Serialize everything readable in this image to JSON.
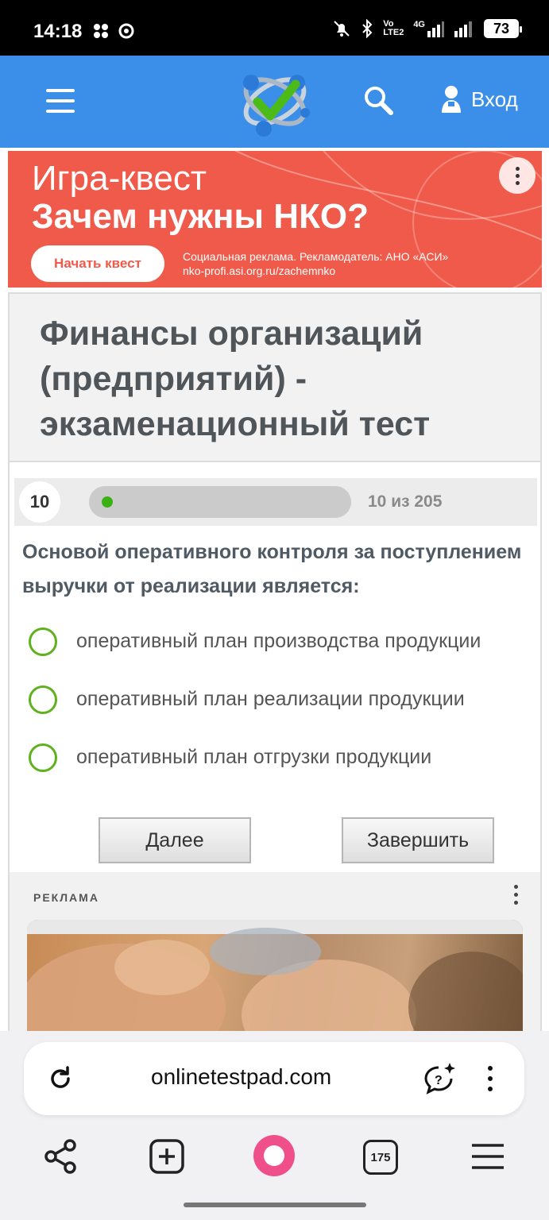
{
  "status_bar": {
    "time": "14:18",
    "network_label_top": "Vo",
    "network_label_bottom": "LTE2",
    "network_type": "4G",
    "battery": "73"
  },
  "header": {
    "login_label": "Вход",
    "icons": [
      "menu-icon",
      "site-logo",
      "search-icon",
      "user-icon"
    ]
  },
  "ad_banner": {
    "title": "Игра-квест",
    "subtitle": "Зачем нужны НКО?",
    "cta": "Начать квест",
    "disclaimer_line1": "Социальная реклама. Рекламодатель: АНО «АСИ»",
    "disclaimer_line2": "nko-profi.asi.org.ru/zachemnko",
    "color": "#f05a4a"
  },
  "test": {
    "title": "Финансы организаций (предприятий) - экзаменационный тест",
    "question_number": "10",
    "progress_text": "10 из 205",
    "progress_fraction": 0.049,
    "question": "Основой оперативного контроля за поступлением выручки от реализации является:",
    "options": [
      "оперативный план производства продукции",
      "оперативный план реализации продукции",
      "оперативный план отгрузки продукции"
    ],
    "next_label": "Далее",
    "finish_label": "Завершить",
    "accent_color": "#5fb21e"
  },
  "ad_section": {
    "label": "РЕКЛАМА"
  },
  "browser": {
    "url": "onlinetestpad.com",
    "tabs_count": "175",
    "assistant_color": "#f0508a"
  }
}
